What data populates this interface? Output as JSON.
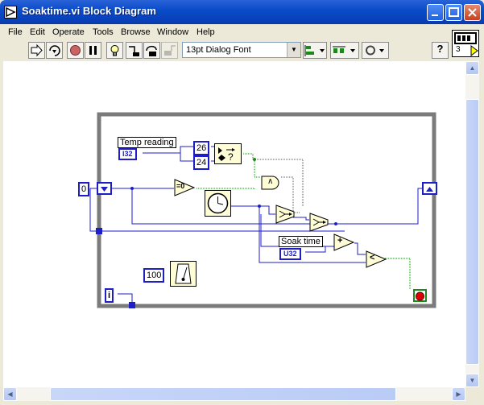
{
  "window": {
    "title": "Soaktime.vi Block Diagram",
    "controls": [
      "minimize",
      "maximize",
      "close"
    ]
  },
  "menu": [
    "File",
    "Edit",
    "Operate",
    "Tools",
    "Browse",
    "Window",
    "Help"
  ],
  "toolbar": {
    "buttons": [
      "run-arrow-icon",
      "run-continuously-icon",
      "abort-icon",
      "pause-icon",
      "highlight-execution-icon",
      "step-into-icon",
      "step-over-icon",
      "step-out-icon"
    ],
    "font": "13pt Dialog Font",
    "help": "?"
  },
  "vi_icon": {
    "number": "3"
  },
  "diagram": {
    "temp_label": "Temp reading",
    "temp_type": "I32",
    "const_26": "26",
    "const_24": "24",
    "const_0": "0",
    "soak_label": "Soak time",
    "soak_type": "U32",
    "const_100": "100",
    "iteration": "i",
    "eq_zero": "=0",
    "and_gate": "∧",
    "add": "+",
    "less": "<"
  },
  "colors": {
    "titlebar": "#0A4CC8",
    "wire_integer": "#1E1EC8",
    "wire_boolean": "#1A8A1A",
    "loop_border": "#7B7B7B",
    "node_fill": "#FFFDD5"
  }
}
